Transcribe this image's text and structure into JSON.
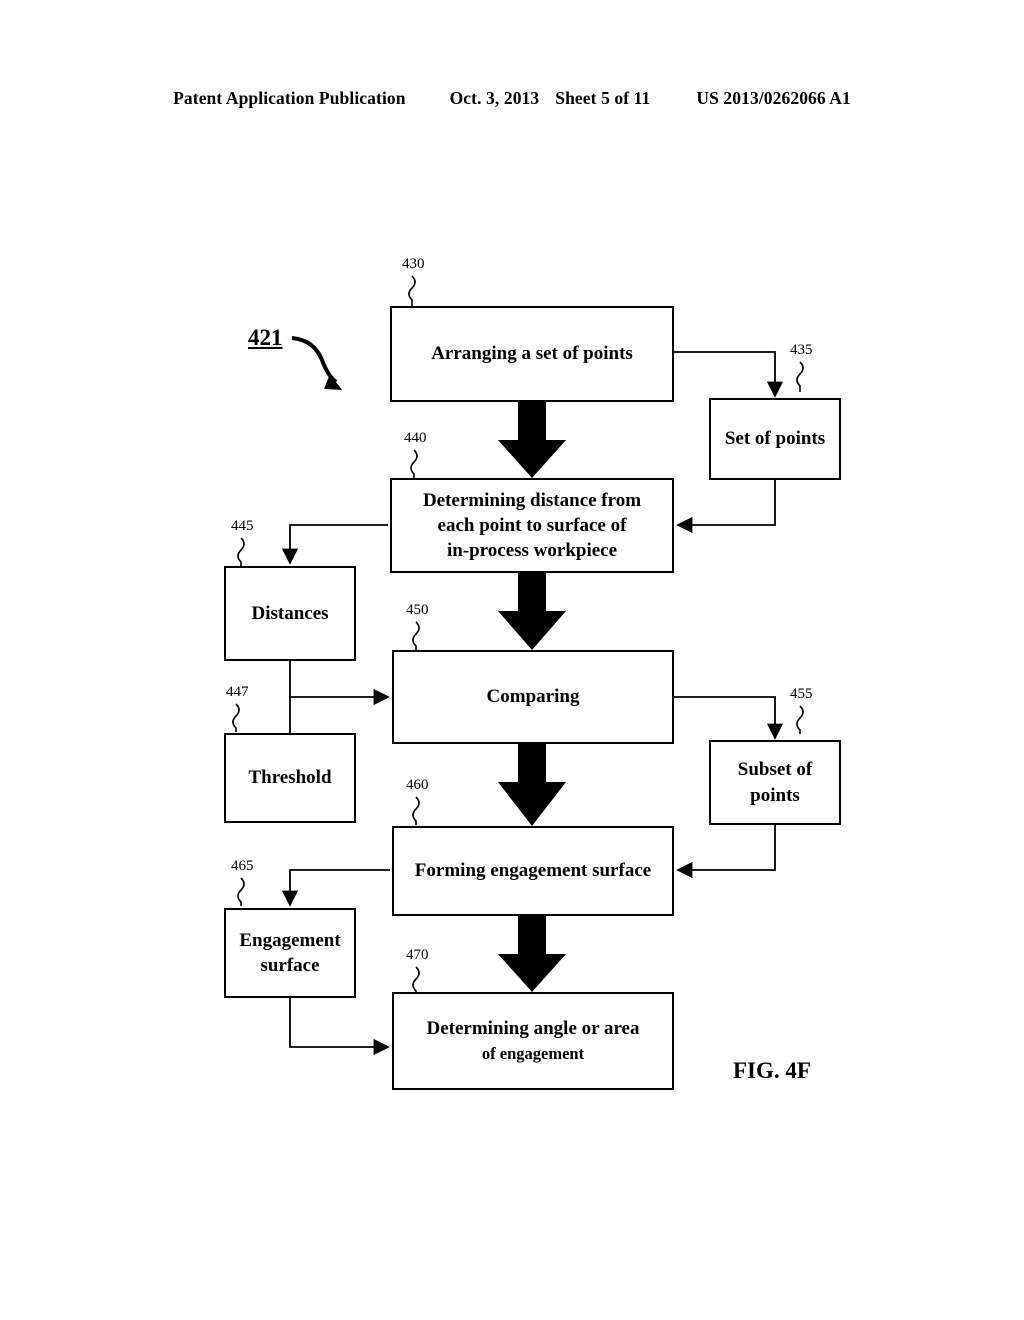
{
  "header": {
    "publication": "Patent Application Publication",
    "date": "Oct. 3, 2013",
    "sheet": "Sheet 5 of 11",
    "number": "US 2013/0262066 A1"
  },
  "figure": {
    "label": "FIG. 4F",
    "flow_ref": "421"
  },
  "nodes": [
    {
      "id": "arranging",
      "ref": "430",
      "text": "Arranging a set of points"
    },
    {
      "id": "set_points",
      "ref": "435",
      "text": "Set of points"
    },
    {
      "id": "determining",
      "ref": "440",
      "line1": "Determining distance from",
      "line2": "each point to surface of",
      "line3": "in-process workpiece"
    },
    {
      "id": "distances",
      "ref": "445",
      "text": "Distances"
    },
    {
      "id": "comparing",
      "ref": "450",
      "text": "Comparing"
    },
    {
      "id": "threshold",
      "ref": "447",
      "text": "Threshold"
    },
    {
      "id": "subset",
      "ref": "455",
      "line1": "Subset of",
      "line2": "points"
    },
    {
      "id": "forming",
      "ref": "460",
      "text": "Forming engagement surface"
    },
    {
      "id": "engagement",
      "ref": "465",
      "line1": "Engagement",
      "line2": "surface"
    },
    {
      "id": "det_angle",
      "ref": "470",
      "line1": "Determining angle or area",
      "line2": "of engagement"
    }
  ],
  "colors": {
    "ink": "#000000",
    "paper": "#ffffff"
  }
}
